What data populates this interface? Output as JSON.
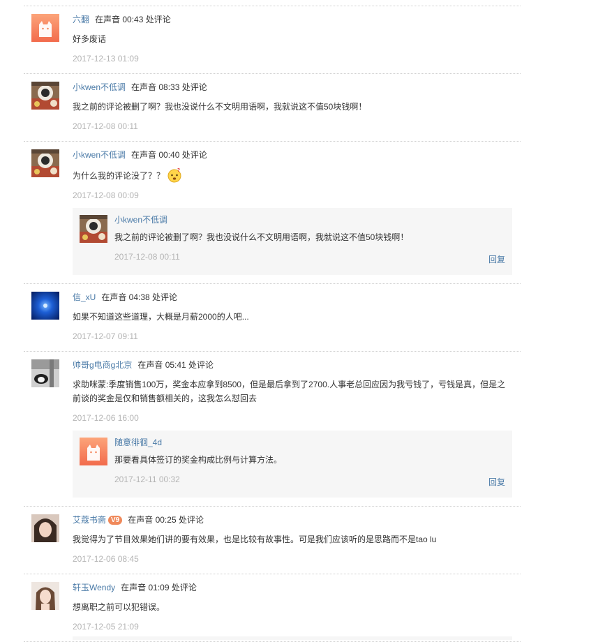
{
  "comments": [
    {
      "avatar": "cat-default-avatar",
      "user": "六翻",
      "badge": "",
      "position": "在声音 00:43 处评论",
      "text": "好多废话",
      "time": "2017-12-13 01:09"
    },
    {
      "avatar": "photo-food-avatar",
      "user": "小kwen不低调",
      "badge": "",
      "position": "在声音 08:33 处评论",
      "text": "我之前的评论被删了啊？我也没说什么不文明用语啊，我就说这不值50块钱啊！",
      "time": "2017-12-08 00:11"
    },
    {
      "avatar": "photo-food-avatar",
      "user": "小kwen不低调",
      "badge": "",
      "position": "在声音 00:40 处评论",
      "text": "为什么我的评论没了？？",
      "emoji": "confused-face-emoji",
      "time": "2017-12-08 00:09",
      "reply": {
        "avatar": "photo-food-avatar",
        "user": "小kwen不低调",
        "text": "我之前的评论被删了啊？我也没说什么不文明用语啊，我就说这不值50块钱啊！",
        "time": "2017-12-08 00:11",
        "reply_label": "回复"
      }
    },
    {
      "avatar": "blue-light-avatar",
      "user": "信_xU",
      "badge": "",
      "position": "在声音 04:38 处评论",
      "text": "如果不知道这些道理，大概是月薪2000的人吧...",
      "time": "2017-12-07 09:11"
    },
    {
      "avatar": "photo-cat-avatar",
      "user": "帅哥g电商g北京",
      "badge": "",
      "position": "在声音 05:41 处评论",
      "text": "求助咪蒙:季度销售100万，奖金本应拿到8500，但是最后拿到了2700.人事老总回应因为我亏钱了，亏钱是真，但是之前谈的奖金是仅和销售额相关的，这我怎么怼回去",
      "time": "2017-12-06 16:00",
      "reply": {
        "avatar": "cat-default-avatar",
        "user": "随意徘徊_4d",
        "text": "那要看具体签订的奖金构成比例与计算方法。",
        "time": "2017-12-11 00:32",
        "reply_label": "回复"
      }
    },
    {
      "avatar": "photo-woman-avatar",
      "user": "艾蔻书斋",
      "badge": "V9",
      "position": "在声音 00:25 处评论",
      "text": "我觉得为了节目效果她们讲的要有效果，也是比较有故事性。可是我们应该听的是思路而不是tao lu",
      "time": "2017-12-06 08:45"
    },
    {
      "avatar": "photo-girl-avatar",
      "user": "轩玉Wendy",
      "badge": "",
      "position": "在声音 01:09 处评论",
      "text": "想离职之前可以犯错误。",
      "time": "2017-12-05 21:09"
    }
  ]
}
